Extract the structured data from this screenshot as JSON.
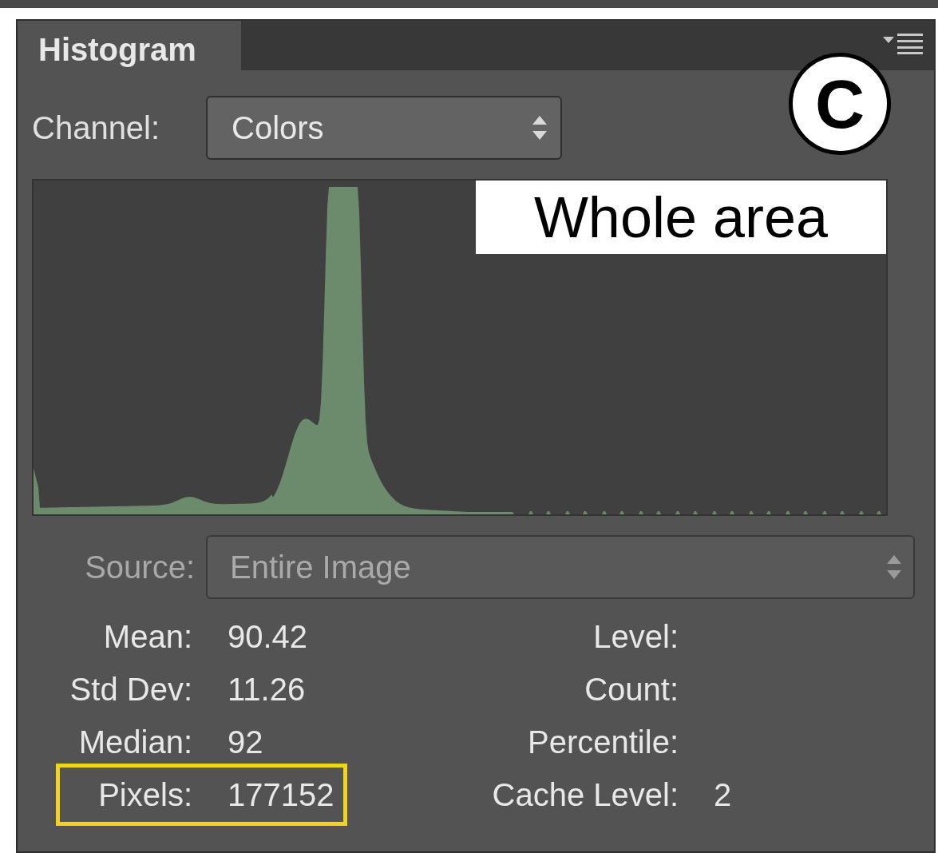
{
  "panel": {
    "tab": {
      "label": "Histogram",
      "selected": true
    },
    "badge": "C",
    "channel": {
      "label": "Channel:",
      "value": "Colors"
    },
    "overlay_label": "Whole area",
    "source": {
      "label": "Source:",
      "value": "Entire Image",
      "disabled": true
    },
    "stats_left": [
      {
        "label": "Mean:",
        "value": "90.42",
        "highlighted": false
      },
      {
        "label": "Std Dev:",
        "value": "11.26",
        "highlighted": false
      },
      {
        "label": "Median:",
        "value": "92",
        "highlighted": false
      },
      {
        "label": "Pixels:",
        "value": "177152",
        "highlighted": true
      }
    ],
    "stats_right": [
      {
        "label": "Level:"
      },
      {
        "label": "Count:"
      },
      {
        "label": "Percentile:"
      },
      {
        "label": "Cache Level:",
        "value": "2"
      }
    ]
  }
}
